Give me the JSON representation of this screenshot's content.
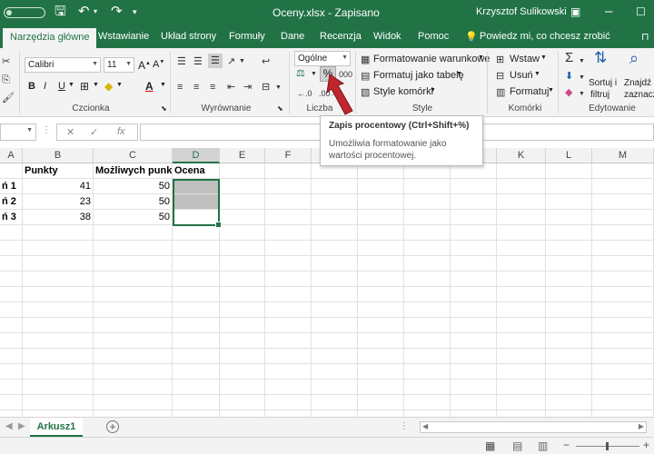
{
  "titlebar": {
    "document_title": "Oceny.xlsx - Zapisano",
    "user_name": "Krzysztof Sulikowski"
  },
  "tabs": [
    {
      "label": "Narzędzia główne",
      "active": true
    },
    {
      "label": "Wstawianie"
    },
    {
      "label": "Układ strony"
    },
    {
      "label": "Formuły"
    },
    {
      "label": "Dane"
    },
    {
      "label": "Recenzja"
    },
    {
      "label": "Widok"
    },
    {
      "label": "Pomoc"
    },
    {
      "label": "Powiedz mi, co chcesz zrobić"
    }
  ],
  "ribbon": {
    "font_name": "Calibri",
    "font_size": "11",
    "number_format": "Ogólne",
    "percent_symbol": "%",
    "thousands_symbol": "000",
    "conditional_formatting": "Formatowanie warunkowe",
    "format_as_table": "Formatuj jako tabelę",
    "cell_styles": "Style komórki",
    "insert": "Wstaw",
    "delete": "Usuń",
    "format": "Formatuj",
    "sort_filter_1": "Sortuj i",
    "sort_filter_2": "filtruj",
    "find_select_1": "Znajdź i",
    "find_select_2": "zaznacz",
    "bold": "B",
    "italic": "I",
    "underline": "U",
    "groups": {
      "font": "Czcionka",
      "alignment": "Wyrównanie",
      "number": "Liczba",
      "styles": "Style",
      "cells": "Komórki",
      "editing": "Edytowanie"
    }
  },
  "tooltip": {
    "title": "Zapis procentowy (Ctrl+Shift+%)",
    "body": "Umożliwia formatowanie jako wartości procentowej."
  },
  "formula_bar": {
    "cancel": "✕",
    "enter": "✓",
    "fx": "fx"
  },
  "columns": [
    "A",
    "B",
    "C",
    "D",
    "E",
    "F",
    "G",
    "H",
    "I",
    "J",
    "K",
    "L",
    "M"
  ],
  "rows": [
    {
      "a": "",
      "b": "Punkty",
      "c": "Możliwych punktów",
      "d": "Ocena"
    },
    {
      "a": "ń 1",
      "b": "41",
      "c": "50",
      "d": ""
    },
    {
      "a": "ń 2",
      "b": "23",
      "c": "50",
      "d": ""
    },
    {
      "a": "ń 3",
      "b": "38",
      "c": "50",
      "d": ""
    }
  ],
  "sheet": {
    "tab_name": "Arkusz1",
    "add_symbol": "+"
  },
  "colors": {
    "accent": "#217346",
    "arrow": "#c0272d"
  }
}
